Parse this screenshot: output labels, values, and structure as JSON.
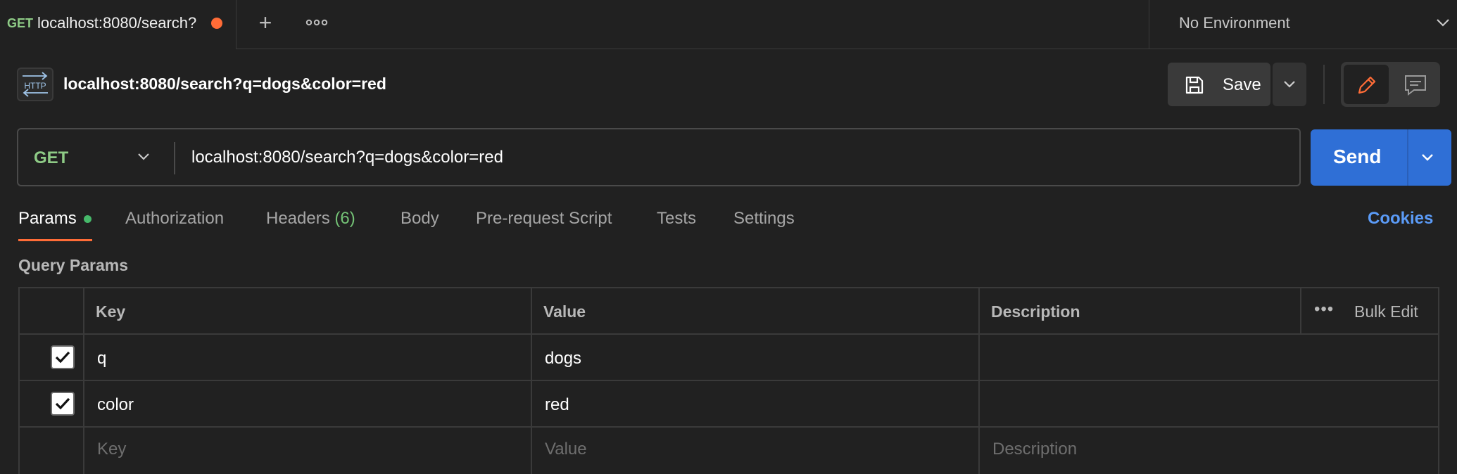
{
  "tab": {
    "method": "GET",
    "title": "localhost:8080/search?",
    "unsaved_dot_color": "#ff6c37"
  },
  "tab_actions": {
    "add_icon": "plus-icon",
    "more_icon": "more-horizontal-icon"
  },
  "environment": {
    "label": "No Environment"
  },
  "request": {
    "title": "localhost:8080/search?q=dogs&color=red",
    "http_icon_label": "HTTP"
  },
  "toolbar": {
    "save_label": "Save"
  },
  "urlbar": {
    "method": "GET",
    "url": "localhost:8080/search?q=dogs&color=red",
    "send_label": "Send"
  },
  "request_tabs": {
    "params": "Params",
    "authorization": "Authorization",
    "headers": "Headers",
    "headers_count": "(6)",
    "body": "Body",
    "prerequest": "Pre-request Script",
    "tests": "Tests",
    "settings": "Settings",
    "cookies": "Cookies"
  },
  "query_params": {
    "title": "Query Params",
    "headers": {
      "key": "Key",
      "value": "Value",
      "description": "Description",
      "bulk_edit": "Bulk Edit"
    },
    "rows": [
      {
        "checked": true,
        "key": "q",
        "value": "dogs",
        "description": ""
      },
      {
        "checked": true,
        "key": "color",
        "value": "red",
        "description": ""
      }
    ],
    "placeholders": {
      "key": "Key",
      "value": "Value",
      "description": "Description"
    }
  },
  "colors": {
    "accent_orange": "#ff6c37",
    "send_blue": "#2f6fd6",
    "method_green": "#8ecb86",
    "link_blue": "#5b9bf7"
  }
}
